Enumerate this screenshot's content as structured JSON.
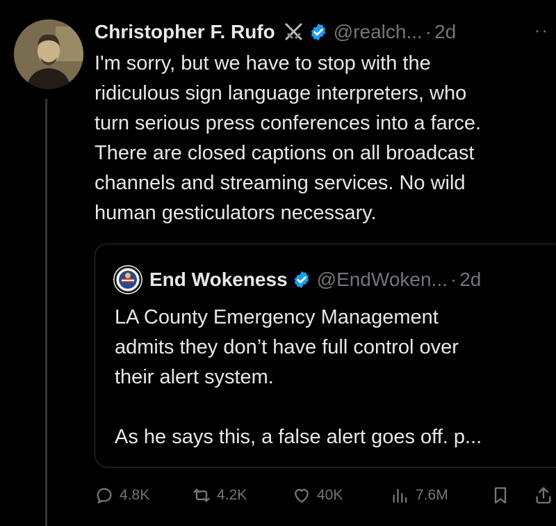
{
  "tweet": {
    "author_name": "Christopher F. Rufo",
    "author_handle": "@realch...",
    "separator": "·",
    "time_ago": "2d",
    "text_lines": [
      "I'm sorry, but we have to stop with the",
      "ridiculous sign language interpreters, who",
      "turn serious press conferences into a farce.",
      "There are closed captions on all broadcast",
      "channels and streaming services. No wild",
      "human gesticulators necessary."
    ]
  },
  "quoted_tweet": {
    "author_name": "End Wokeness",
    "author_handle": "@EndWoken...",
    "separator": "·",
    "time_ago": "2d",
    "text_lines": [
      "LA County Emergency Management",
      "admits they don’t have full control over",
      "their alert system."
    ],
    "text_second_paragraph": "As he says this, a false alert goes off. p..."
  },
  "actions": {
    "replies": "4.8K",
    "reposts": "4.2K",
    "likes": "40K",
    "views": "7.6M"
  },
  "colors": {
    "background": "#000000",
    "text": "#e7e9ea",
    "secondary": "#71767b",
    "verified": "#1d9bf0",
    "border": "#2f3336"
  }
}
